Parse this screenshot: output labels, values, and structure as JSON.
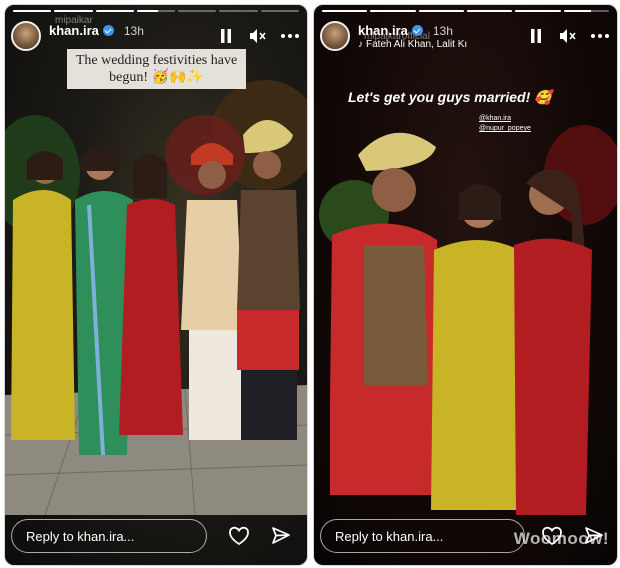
{
  "stories": [
    {
      "id_label": "left",
      "progress": [
        1,
        1,
        1,
        0.55,
        0,
        0,
        0
      ],
      "collab_label": "mipaikar",
      "username": "khan.ira",
      "time": "13h",
      "caption": "The wedding festivities have begun!",
      "caption_emoji": "🥳🙌✨",
      "reply_placeholder": "Reply to khan.ira...",
      "icons": [
        "pause-icon",
        "mute-icon",
        "more-icon",
        "heart-icon",
        "send-icon"
      ]
    },
    {
      "id_label": "right",
      "progress": [
        1,
        1,
        1,
        1,
        1,
        0.6
      ],
      "collab_label": "mipaikarofficial",
      "username": "khan.ira",
      "time": "13h",
      "music": "Fateh Ali Khan, Lalit Kı",
      "story_text": "Let's get you guys married!",
      "story_emoji": "🥰",
      "mentions": [
        "@khan.ira",
        "@nupur_popeye"
      ],
      "reply_placeholder": "Reply to khan.ira...",
      "watermark": "Woomoow!",
      "icons": [
        "pause-icon",
        "mute-icon",
        "more-icon",
        "heart-icon",
        "send-icon"
      ]
    }
  ],
  "colors": {
    "verified": "#3897f0",
    "yellow_saree": "#c8b426",
    "red_outfit": "#b21d22",
    "green_saree": "#2f8f5b",
    "turban": "#d9c77a"
  }
}
